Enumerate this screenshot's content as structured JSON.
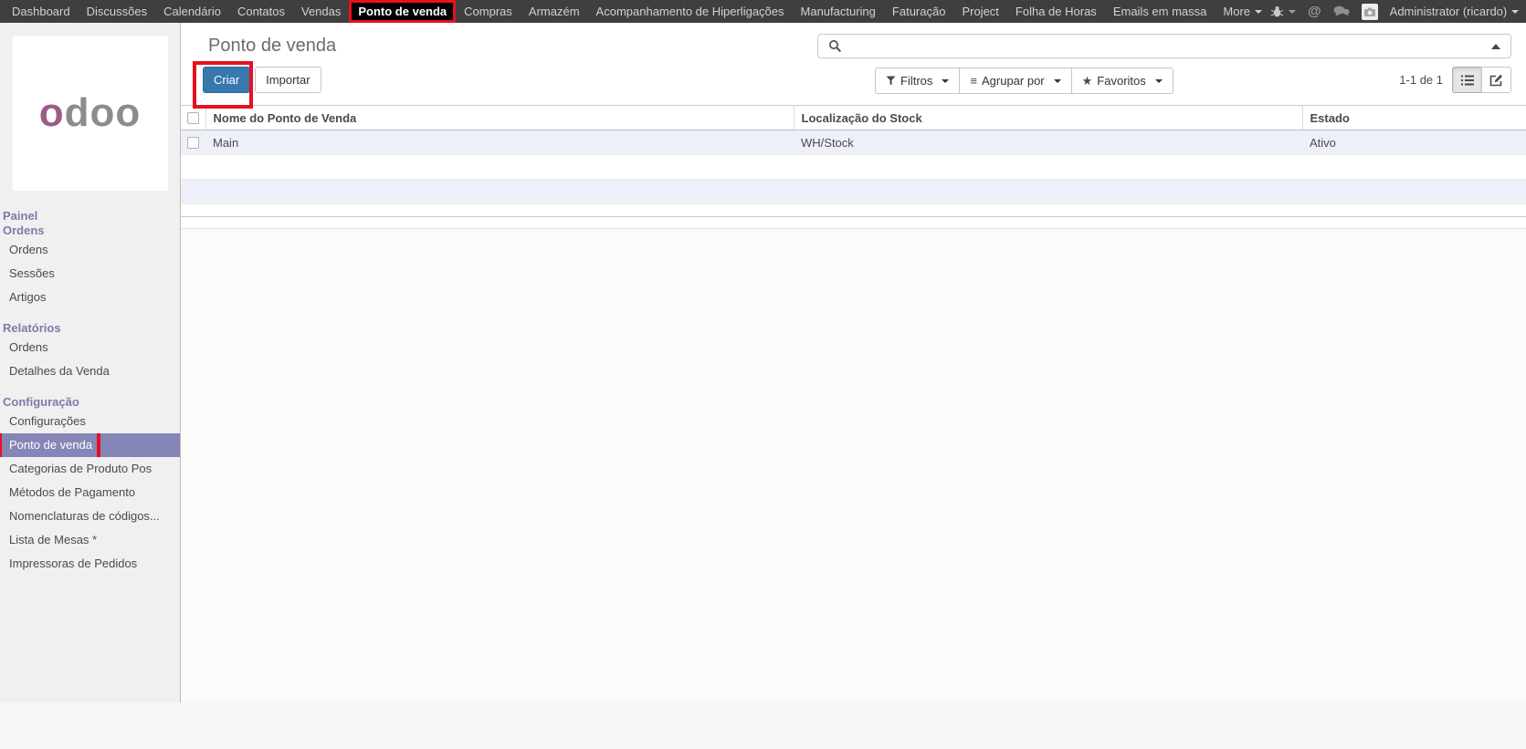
{
  "colors": {
    "annotation_red": "#e8101f",
    "accent_purple": "#7b7ca9",
    "selected_purple": "#8586b7",
    "primary_button_blue": "#3778af",
    "row_stripe": "#eef0f9",
    "topbar_bg": "#3f3f3f",
    "logo_purple": "#9a5c84"
  },
  "topbar": {
    "items": [
      "Dashboard",
      "Discussões",
      "Calendário",
      "Contatos",
      "Vendas",
      "Ponto de venda",
      "Compras",
      "Armazém",
      "Acompanhamento de Hiperligações",
      "Manufacturing",
      "Faturação",
      "Project",
      "Folha de Horas",
      "Emails em massa"
    ],
    "active_item": "Ponto de venda",
    "more_label": "More",
    "icons": {
      "mention": "@"
    },
    "user_label": "Administrator (ricardo)"
  },
  "sidebar": {
    "logo_first": "o",
    "logo_rest": "doo",
    "sections": [
      {
        "label": "Painel",
        "items": []
      },
      {
        "label": "Ordens",
        "items": [
          "Ordens",
          "Sessões",
          "Artigos"
        ]
      },
      {
        "label": "Relatórios",
        "items": [
          "Ordens",
          "Detalhes da Venda"
        ]
      },
      {
        "label": "Configuração",
        "items": [
          "Configurações",
          "Ponto de venda",
          "Categorias de Produto Pos",
          "Métodos de Pagamento",
          "Nomenclaturas de códigos...",
          "Lista de Mesas *",
          "Impressoras de Pedidos"
        ]
      }
    ],
    "selected_item": "Ponto de venda"
  },
  "control_panel": {
    "title": "Ponto de venda",
    "create_label": "Criar",
    "import_label": "Importar",
    "search_placeholder": "",
    "search_value": "",
    "filters_label": "Filtros",
    "group_by_label": "Agrupar por",
    "group_by_glyph": "≡",
    "favorites_label": "Favoritos",
    "favorites_glyph": "★",
    "pager": "1-1 de 1"
  },
  "table": {
    "columns": [
      "Nome do Ponto de Venda",
      "Localização do Stock",
      "Estado"
    ],
    "rows": [
      {
        "name": "Main",
        "location": "WH/Stock",
        "state": "Ativo"
      }
    ]
  }
}
